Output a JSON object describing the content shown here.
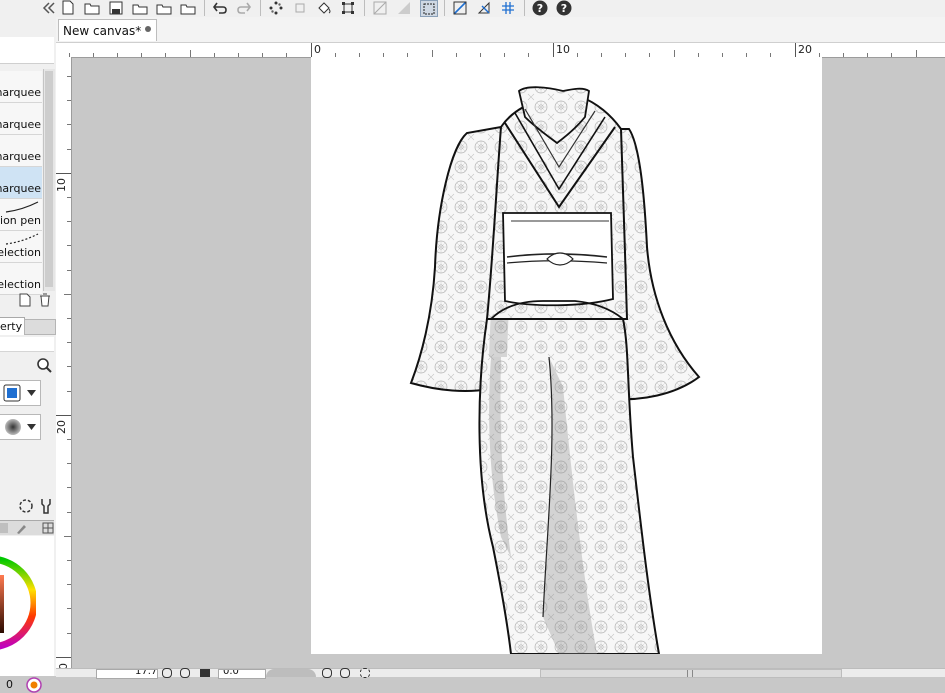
{
  "tab": {
    "title": "New canvas*"
  },
  "ruler": {
    "top_labels": [
      "0",
      "10",
      "20"
    ],
    "left_labels": [
      "10",
      "20",
      "0"
    ]
  },
  "subtools": [
    {
      "label": "marquee",
      "selected": false
    },
    {
      "label": "marquee",
      "selected": false
    },
    {
      "label": "marquee",
      "selected": false
    },
    {
      "label": "marquee",
      "selected": true
    },
    {
      "label": "tion pen",
      "selected": false
    },
    {
      "label": "election",
      "selected": false
    },
    {
      "label": "election",
      "selected": false
    }
  ],
  "property_tab": {
    "label": "erty"
  },
  "status": {
    "zoom_partial": "17.7",
    "angle_partial": "0.0"
  },
  "color_value": "0",
  "colors": {
    "selection": "#cfe3f4",
    "panel": "#f0f0f0",
    "workspace": "#c8c8c8",
    "accent_blue": "#1f6fd1"
  }
}
